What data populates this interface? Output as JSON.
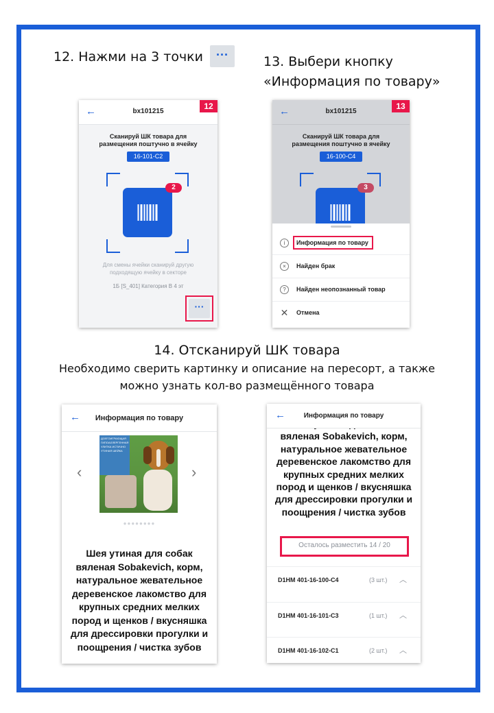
{
  "step12": {
    "title": "12. Нажми на 3 точки",
    "dots_chip": "···",
    "screen": {
      "header_title": "bx101215",
      "badge": "12",
      "scan_text": "Сканируй ШК товара для размещения поштучно в ячейку",
      "cell": "16-101-C2",
      "count": "2",
      "hint": "Для смены ячейки сканируй другую подходящую ячейку в секторе",
      "category": "1Б [S_401] Категория В 4 эт",
      "more_button": "···"
    }
  },
  "step13": {
    "title_line1": "13. Выбери кнопку",
    "title_line2": "«Информация по товару»",
    "screen": {
      "header_title": "bx101215",
      "badge": "13",
      "scan_text": "Сканируй ШК товара для размещения поштучно в ячейку",
      "cell": "16-100-C4",
      "count": "3",
      "menu": [
        {
          "icon": "info-icon",
          "glyph": "i",
          "label": "Информация по товару"
        },
        {
          "icon": "defect-icon",
          "glyph": "×",
          "label": "Найден брак"
        },
        {
          "icon": "question-icon",
          "glyph": "?",
          "label": "Найден неопознанный товар"
        },
        {
          "icon": "close-icon",
          "glyph": "✕",
          "label": "Отмена"
        }
      ]
    }
  },
  "step14": {
    "title": "14. Отсканируй ШК товара",
    "subtitle_line1": "Необходимо сверить картинку и описание на пересорт, а также",
    "subtitle_line2": "можно узнать кол-во размещённого товара",
    "screen_a": {
      "header_title": "Информация по товару",
      "photo_text": "ДОЛГОИГРАЮЩАЯ ГИПОАЛЛЕРГЕННАЯ УЛИТКА ИСТИЧНО УТИНАЯ ШЕЙКА",
      "pager": "●●●●●●●●",
      "product": "Шея утиная для собак вяленая Sobakevich, корм, натуральное жевательное деревенское лакомство для крупных средних мелких пород и щенков / вкусняшка для дрессировки прогулки и поощрения / чистка зубов"
    },
    "screen_b": {
      "header_title": "Информация по товару",
      "product": "Шея утиная для собак вяленая Sobakevich, корм, натуральное жевательное деревенское лакомство для крупных средних мелких пород и щенков / вкусняшка для дрессировки прогулки и поощрения / чистка зубов",
      "left_to_place": "Осталось разместить 14 / 20",
      "locations": [
        {
          "code": "D1HM 401-16-100-C4",
          "qty": "(3 шт.)"
        },
        {
          "code": "D1HM 401-16-101-C3",
          "qty": "(1 шт.)"
        },
        {
          "code": "D1HM 401-16-102-C1",
          "qty": "(2 шт.)"
        }
      ]
    }
  },
  "colors": {
    "accent": "#1a5ed8",
    "highlight": "#e8174a"
  }
}
